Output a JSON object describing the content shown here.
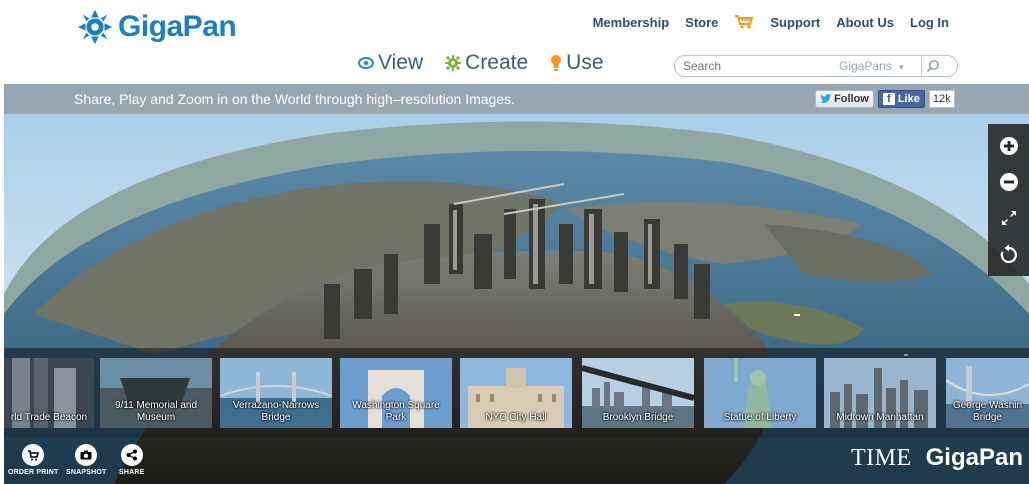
{
  "header": {
    "logo_text": "GigaPan",
    "top_links": [
      {
        "label": "Membership"
      },
      {
        "label": "Store"
      },
      {
        "label": "Support"
      },
      {
        "label": "About Us"
      },
      {
        "label": "Log In"
      }
    ],
    "main_nav": [
      {
        "label": "View",
        "icon": "eye-icon",
        "color": "#1b8fd0"
      },
      {
        "label": "Create",
        "icon": "gear-icon",
        "color": "#7bb33a"
      },
      {
        "label": "Use",
        "icon": "lightbulb-icon",
        "color": "#f39a1f"
      }
    ],
    "search": {
      "placeholder": "Search",
      "scope": "GigaPans",
      "scope_arrow": "▾"
    }
  },
  "tagbar": {
    "tagline": "Share, Play and Zoom in on the World through high–resolution Images.",
    "follow_label": "Follow",
    "like_label": "Like",
    "like_count": "12k"
  },
  "thumbnails": [
    {
      "caption": "rld Trade Beacon"
    },
    {
      "caption": "9/11 Memorial and Museum"
    },
    {
      "caption": "Verrazano-Narrows Bridge"
    },
    {
      "caption": "Washington Square Park"
    },
    {
      "caption": "NYC City Hall"
    },
    {
      "caption": "Brooklyn Bridge"
    },
    {
      "caption": "Statue of Liberty"
    },
    {
      "caption": "Midtown Manhattan"
    },
    {
      "caption": "George Washin Bridge"
    }
  ],
  "controls": {
    "order_print": "ORDER PRINT",
    "snapshot": "SNAPSHOT",
    "share": "SHARE"
  },
  "brand": {
    "time": "TIME",
    "gigapan": "GigaPan"
  },
  "colors": {
    "logo_blue": "#1b7fc4",
    "nav_text": "#2a4f73",
    "tagbar_bg": "#97a7b1",
    "cart_orange": "#f39a1f"
  }
}
